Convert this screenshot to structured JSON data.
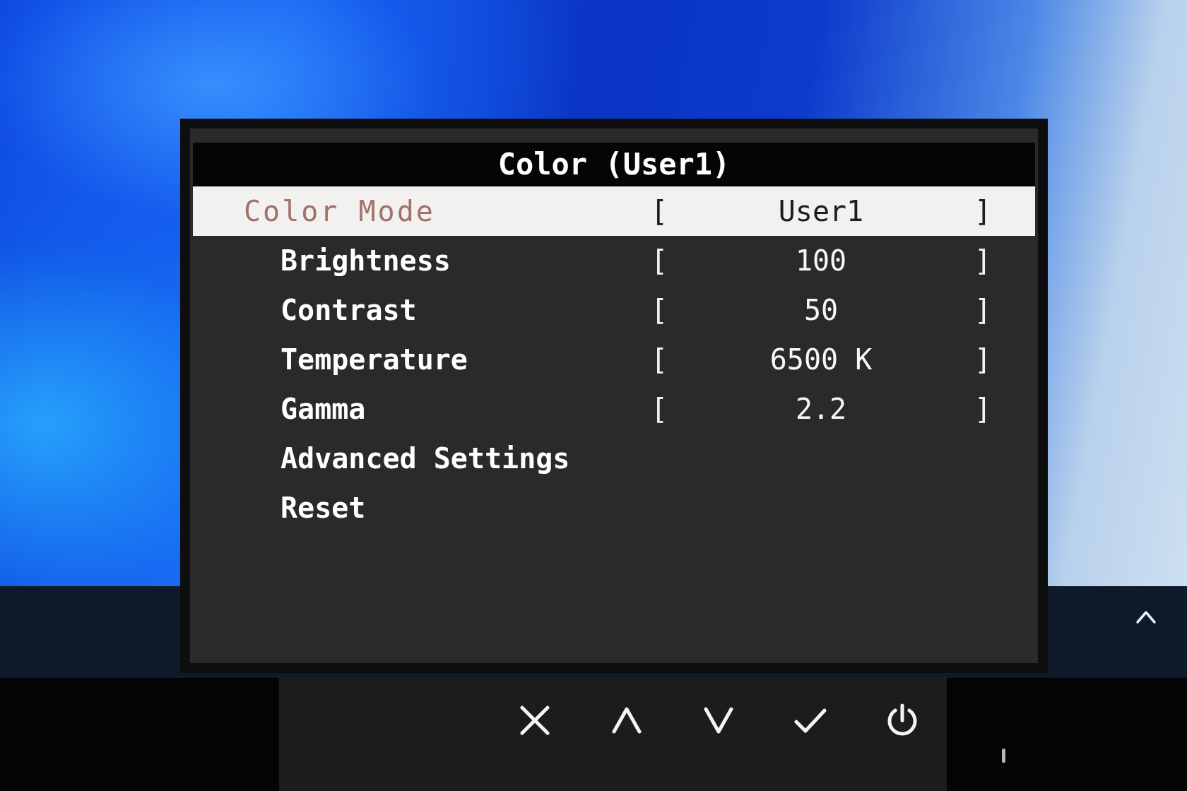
{
  "osd": {
    "title": "Color (User1)",
    "items": [
      {
        "kind": "mode",
        "label": "Color Mode",
        "brackets": [
          "[",
          "]"
        ],
        "value": "User1",
        "selected": true
      },
      {
        "kind": "setting",
        "label": "Brightness",
        "brackets": [
          "[",
          "]"
        ],
        "value": "100",
        "selected": false
      },
      {
        "kind": "setting",
        "label": "Contrast",
        "brackets": [
          "[",
          "]"
        ],
        "value": "50",
        "selected": false
      },
      {
        "kind": "setting",
        "label": "Temperature",
        "brackets": [
          "[",
          "]"
        ],
        "value": "6500 K",
        "selected": false
      },
      {
        "kind": "setting",
        "label": "Gamma",
        "brackets": [
          "[",
          "]"
        ],
        "value": "2.2",
        "selected": false
      },
      {
        "kind": "setting",
        "label": "Advanced Settings",
        "selected": false
      },
      {
        "kind": "setting",
        "label": "Reset",
        "selected": false
      }
    ]
  },
  "key_guide": [
    {
      "kind": "close"
    },
    {
      "kind": "up"
    },
    {
      "kind": "down"
    },
    {
      "kind": "confirm"
    },
    {
      "kind": "power"
    }
  ]
}
